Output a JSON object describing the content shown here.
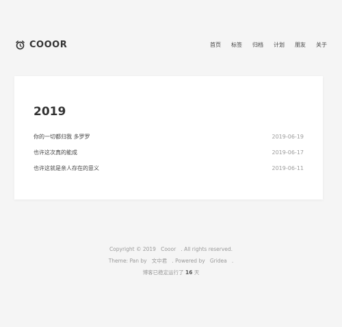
{
  "header": {
    "brand": "COOOR",
    "nav": [
      "首页",
      "标签",
      "归档",
      "计划",
      "朋友",
      "关于"
    ]
  },
  "archive": {
    "year": "2019",
    "posts": [
      {
        "title": "你的一切都归我 多罗罗",
        "date": "2019-06-19"
      },
      {
        "title": "也许这次真的能成",
        "date": "2019-06-17"
      },
      {
        "title": "也许这就是亲人存在的意义",
        "date": "2019-06-11"
      }
    ]
  },
  "footer": {
    "copyright_prefix": "Copyright © 2019",
    "copyright_name": "Cooor",
    "copyright_suffix": ". All rights reserved.",
    "theme_prefix": "Theme: Pan by",
    "theme_author": "文中君",
    "powered_prefix": ". Powered by",
    "powered_name": "Gridea",
    "powered_suffix": ".",
    "uptime_prefix": "博客已稳定运行了",
    "uptime_days": "16",
    "uptime_suffix": "天"
  },
  "colors": {
    "background": "#f5f5f5",
    "card": "#ffffff",
    "text": "#333333",
    "muted": "#999999"
  }
}
